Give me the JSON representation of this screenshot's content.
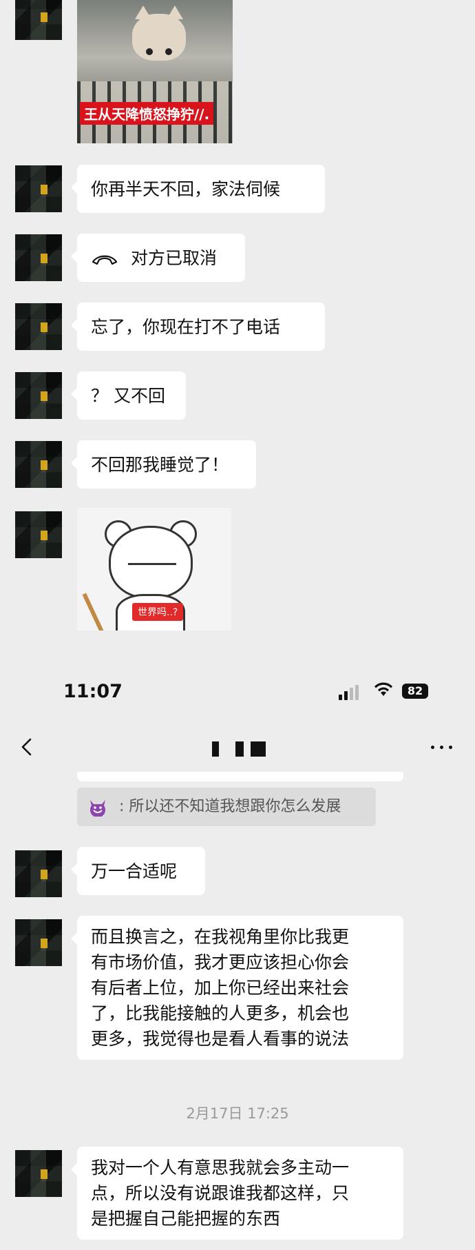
{
  "messages_top": [
    {
      "type": "image",
      "caption": "王从天降愤怒挣狞//."
    },
    {
      "type": "text",
      "text": "你再半天不回，家法伺候"
    },
    {
      "type": "call",
      "text": "对方已取消"
    },
    {
      "type": "text",
      "text": "忘了，你现在打不了电话"
    },
    {
      "type": "text",
      "text": "？ 又不回"
    },
    {
      "type": "text",
      "text": "不回那我睡觉了！"
    },
    {
      "type": "sticker",
      "caption": "世界吗..?"
    }
  ],
  "status_bar": {
    "time": "11:07",
    "battery": "82"
  },
  "nav": {
    "back_icon": "chevron-left-icon",
    "more_icon": "more-dots-icon"
  },
  "quote": {
    "emoji": "smiling-devil-emoji",
    "text": "所以还不知道我想跟你怎么发展"
  },
  "messages_bottom": [
    {
      "type": "text",
      "text": "万一合适呢"
    },
    {
      "type": "text",
      "lines": [
        "而且换言之，在我视角里你比我更",
        "有市场价值，我才更应该担心你会",
        "有后者上位，加上你已经出来社会",
        "了，比我能接触的人更多，机会也",
        "更多，我觉得也是看人看事的说法"
      ]
    },
    {
      "type": "text",
      "lines": [
        "我对一个人有意思我就会多主动一",
        "点，所以没有说跟谁我都这样，只",
        "是把握自己能把握的东西"
      ]
    }
  ],
  "timestamp": "2月17日 17:25"
}
